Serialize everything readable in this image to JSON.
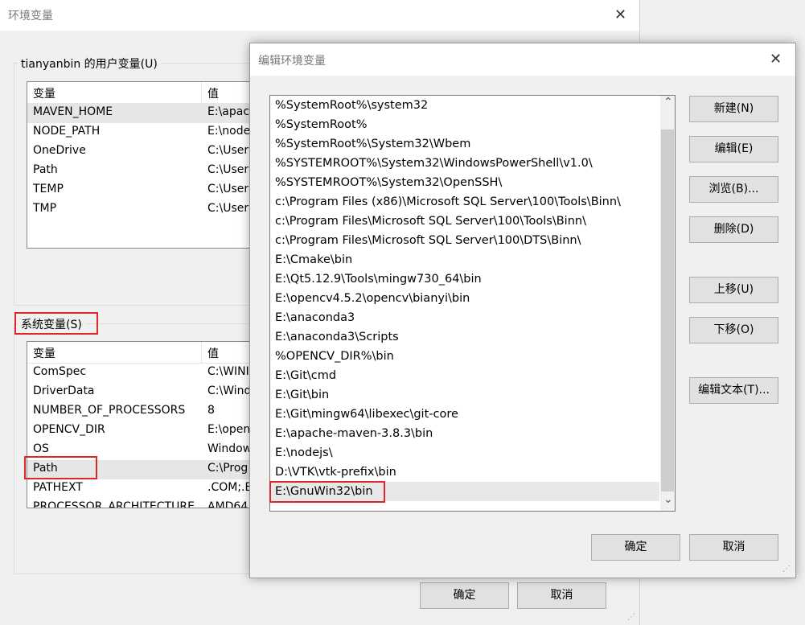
{
  "env_dialog": {
    "title": "环境变量",
    "user_vars": {
      "group_label": "tianyanbin 的用户变量(U)",
      "headers": [
        "变量",
        "值"
      ],
      "rows": [
        {
          "name": "MAVEN_HOME",
          "value": "E:\\apac"
        },
        {
          "name": "NODE_PATH",
          "value": "E:\\node"
        },
        {
          "name": "OneDrive",
          "value": "C:\\User"
        },
        {
          "name": "Path",
          "value": "C:\\User"
        },
        {
          "name": "TEMP",
          "value": "C:\\User"
        },
        {
          "name": "TMP",
          "value": "C:\\User"
        }
      ]
    },
    "system_vars": {
      "group_label": "系统变量(S)",
      "headers": [
        "变量",
        "值"
      ],
      "rows": [
        {
          "name": "ComSpec",
          "value": "C:\\WINI"
        },
        {
          "name": "DriverData",
          "value": "C:\\Wind"
        },
        {
          "name": "NUMBER_OF_PROCESSORS",
          "value": "8"
        },
        {
          "name": "OPENCV_DIR",
          "value": "E:\\open"
        },
        {
          "name": "OS",
          "value": "Window"
        },
        {
          "name": "Path",
          "value": "C:\\Prog"
        },
        {
          "name": "PATHEXT",
          "value": ".COM;.E"
        },
        {
          "name": "PROCESSOR_ARCHITECTURE",
          "value": "AMD64"
        }
      ]
    },
    "ok_label": "确定",
    "cancel_label": "取消"
  },
  "edit_dialog": {
    "title": "编辑环境变量",
    "paths": [
      "%SystemRoot%\\system32",
      "%SystemRoot%",
      "%SystemRoot%\\System32\\Wbem",
      "%SYSTEMROOT%\\System32\\WindowsPowerShell\\v1.0\\",
      "%SYSTEMROOT%\\System32\\OpenSSH\\",
      "c:\\Program Files (x86)\\Microsoft SQL Server\\100\\Tools\\Binn\\",
      "c:\\Program Files\\Microsoft SQL Server\\100\\Tools\\Binn\\",
      "c:\\Program Files\\Microsoft SQL Server\\100\\DTS\\Binn\\",
      "E:\\Cmake\\bin",
      "E:\\Qt5.12.9\\Tools\\mingw730_64\\bin",
      "E:\\opencv4.5.2\\opencv\\bianyi\\bin",
      "E:\\anaconda3",
      "E:\\anaconda3\\Scripts",
      "%OPENCV_DIR%\\bin",
      "E:\\Git\\cmd",
      "E:\\Git\\bin",
      "E:\\Git\\mingw64\\libexec\\git-core",
      "E:\\apache-maven-3.8.3\\bin",
      "E:\\nodejs\\",
      "D:\\VTK\\vtk-prefix\\bin",
      "E:\\GnuWin32\\bin"
    ],
    "buttons": {
      "new": "新建(N)",
      "edit": "编辑(E)",
      "browse": "浏览(B)...",
      "delete": "删除(D)",
      "move_up": "上移(U)",
      "move_down": "下移(O)",
      "edit_text": "编辑文本(T)..."
    },
    "ok_label": "确定",
    "cancel_label": "取消"
  },
  "icons": {
    "close": "✕",
    "scroll_up": "⌃",
    "scroll_down": "⌄",
    "grip": "⋰"
  },
  "colors": {
    "highlight_border": "#e0262b",
    "selection": "#e6e6e6"
  }
}
